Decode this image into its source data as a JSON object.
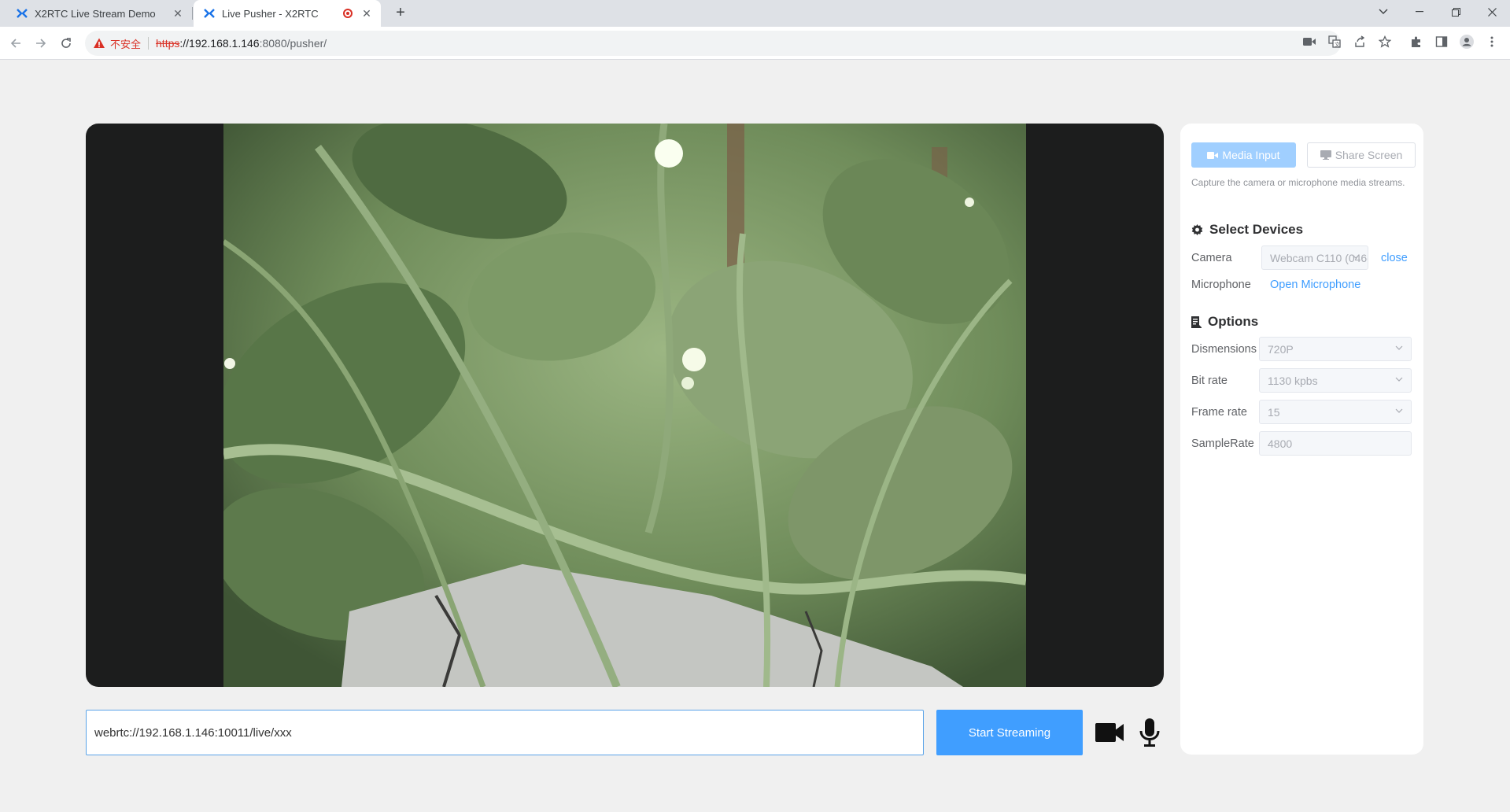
{
  "browser": {
    "tabs": [
      {
        "title": "X2RTC Live Stream Demo",
        "active": false
      },
      {
        "title": "Live Pusher - X2RTC",
        "active": true,
        "recording": true
      }
    ],
    "address": {
      "security_label": "不安全",
      "scheme": "https",
      "host_rest": "://192.168.1.146",
      "port_path": ":8080/pusher/"
    }
  },
  "stream": {
    "url_value": "webrtc://192.168.1.146:10011/live/xxx",
    "start_label": "Start Streaming"
  },
  "panel": {
    "media_input_label": "Media Input",
    "share_screen_label": "Share Screen",
    "hint": "Capture the camera or microphone media streams.",
    "devices_title": "Select Devices",
    "camera_label": "Camera",
    "camera_value": "Webcam C110 (046d:",
    "camera_close": "close",
    "microphone_label": "Microphone",
    "microphone_action": "Open Microphone",
    "options_title": "Options",
    "dimensions_label": "Dismensions",
    "dimensions_value": "720P",
    "bitrate_label": "Bit rate",
    "bitrate_value": "1130 kpbs",
    "framerate_label": "Frame rate",
    "framerate_value": "15",
    "samplerate_label": "SampleRate",
    "samplerate_value": "4800"
  },
  "colors": {
    "accent": "#409eff",
    "accent_light": "#a0cfff",
    "video_bg": "#1c1d1d",
    "page_bg": "#f0f0f0"
  },
  "icons": {
    "tab_favicon": "x2rtc-logo-icon",
    "camera_toggle": "video-camera-icon",
    "mic_toggle": "microphone-icon"
  }
}
